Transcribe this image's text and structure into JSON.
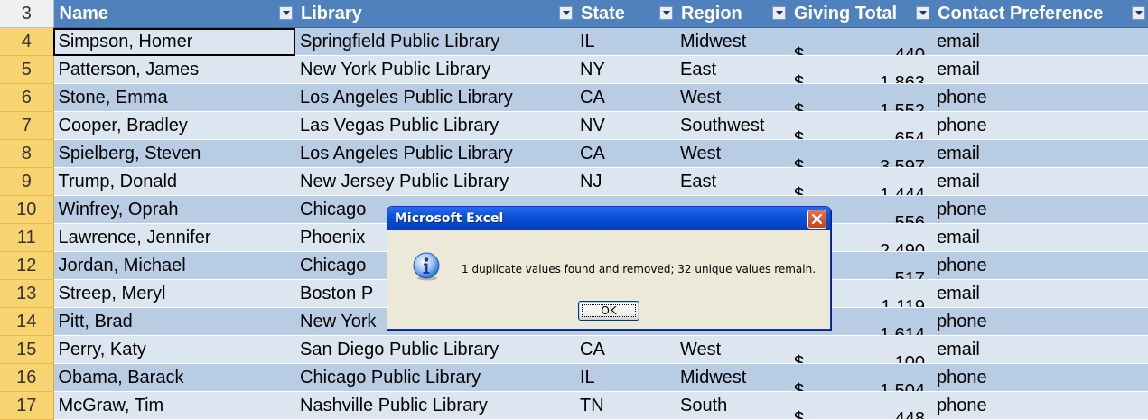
{
  "sheet": {
    "header_row_number": "3",
    "columns": [
      "Name",
      "Library",
      "State",
      "Region",
      "Giving Total",
      "Contact Preference"
    ],
    "rows": [
      {
        "row": "4",
        "name": "Simpson, Homer",
        "library": "Springfield Public Library",
        "state": "IL",
        "region": "Midwest",
        "currency": "$",
        "giving": "440",
        "contact": "email"
      },
      {
        "row": "5",
        "name": "Patterson, James",
        "library": "New York Public Library",
        "state": "NY",
        "region": "East",
        "currency": "$",
        "giving": "1,863",
        "contact": "email"
      },
      {
        "row": "6",
        "name": "Stone, Emma",
        "library": "Los Angeles Public Library",
        "state": "CA",
        "region": "West",
        "currency": "$",
        "giving": "1,552",
        "contact": "phone"
      },
      {
        "row": "7",
        "name": "Cooper, Bradley",
        "library": "Las Vegas Public Library",
        "state": "NV",
        "region": "Southwest",
        "currency": "$",
        "giving": "654",
        "contact": "phone"
      },
      {
        "row": "8",
        "name": "Spielberg, Steven",
        "library": "Los Angeles Public Library",
        "state": "CA",
        "region": "West",
        "currency": "$",
        "giving": "3,597",
        "contact": "email"
      },
      {
        "row": "9",
        "name": "Trump, Donald",
        "library": "New Jersey Public Library",
        "state": "NJ",
        "region": "East",
        "currency": "$",
        "giving": "1,444",
        "contact": "email"
      },
      {
        "row": "10",
        "name": "Winfrey, Oprah",
        "library": "Chicago",
        "state": "",
        "region": "",
        "currency": "",
        "giving": "556",
        "contact": "phone"
      },
      {
        "row": "11",
        "name": "Lawrence, Jennifer",
        "library": "Phoenix",
        "state": "",
        "region": "",
        "currency": "",
        "giving": "2,490",
        "contact": "email"
      },
      {
        "row": "12",
        "name": "Jordan, Michael",
        "library": "Chicago",
        "state": "",
        "region": "",
        "currency": "",
        "giving": "517",
        "contact": "phone"
      },
      {
        "row": "13",
        "name": "Streep, Meryl",
        "library": "Boston P",
        "state": "",
        "region": "",
        "currency": "",
        "giving": "1,119",
        "contact": "email"
      },
      {
        "row": "14",
        "name": "Pitt, Brad",
        "library": "New York",
        "state": "",
        "region": "",
        "currency": "",
        "giving": "1,614",
        "contact": "phone"
      },
      {
        "row": "15",
        "name": "Perry, Katy",
        "library": "San Diego Public Library",
        "state": "CA",
        "region": "West",
        "currency": "$",
        "giving": "100",
        "contact": "email"
      },
      {
        "row": "16",
        "name": "Obama, Barack",
        "library": "Chicago Public Library",
        "state": "IL",
        "region": "Midwest",
        "currency": "$",
        "giving": "1,504",
        "contact": "phone"
      },
      {
        "row": "17",
        "name": "McGraw, Tim",
        "library": "Nashville Public Library",
        "state": "TN",
        "region": "South",
        "currency": "$",
        "giving": "448",
        "contact": "phone"
      }
    ]
  },
  "dialog": {
    "title": "Microsoft Excel",
    "message": "1 duplicate values found and removed; 32 unique values remain.",
    "ok_label": "OK",
    "icon": "info-icon"
  },
  "colors": {
    "header": "#4f81bd",
    "band_dark": "#b8cce4",
    "band_light": "#dce6f1",
    "row_numbers": "#f8d470",
    "titlebar": "#0a53d8"
  }
}
